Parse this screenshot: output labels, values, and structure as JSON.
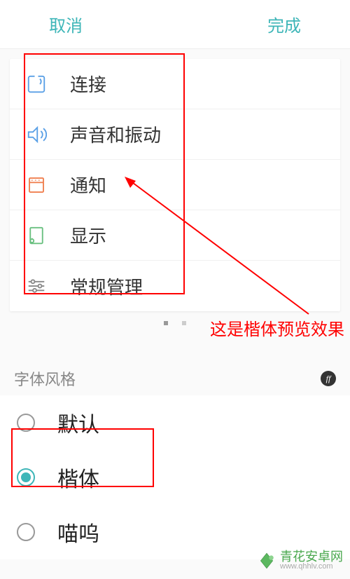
{
  "header": {
    "cancel": "取消",
    "done": "完成"
  },
  "preview": {
    "items": [
      {
        "icon": "connect",
        "label": "连接"
      },
      {
        "icon": "sound",
        "label": "声音和振动"
      },
      {
        "icon": "notify",
        "label": "通知"
      },
      {
        "icon": "display",
        "label": "显示"
      },
      {
        "icon": "general",
        "label": "常规管理"
      }
    ]
  },
  "annotation": "这是楷体预览效果",
  "section_title": "字体风格",
  "ff_badge": "ff",
  "fonts": [
    {
      "label": "默认",
      "selected": false
    },
    {
      "label": "楷体",
      "selected": true
    },
    {
      "label": "喵呜",
      "selected": false
    }
  ],
  "watermark": {
    "name": "青花安卓网",
    "url": "www.qhhlv.com"
  }
}
